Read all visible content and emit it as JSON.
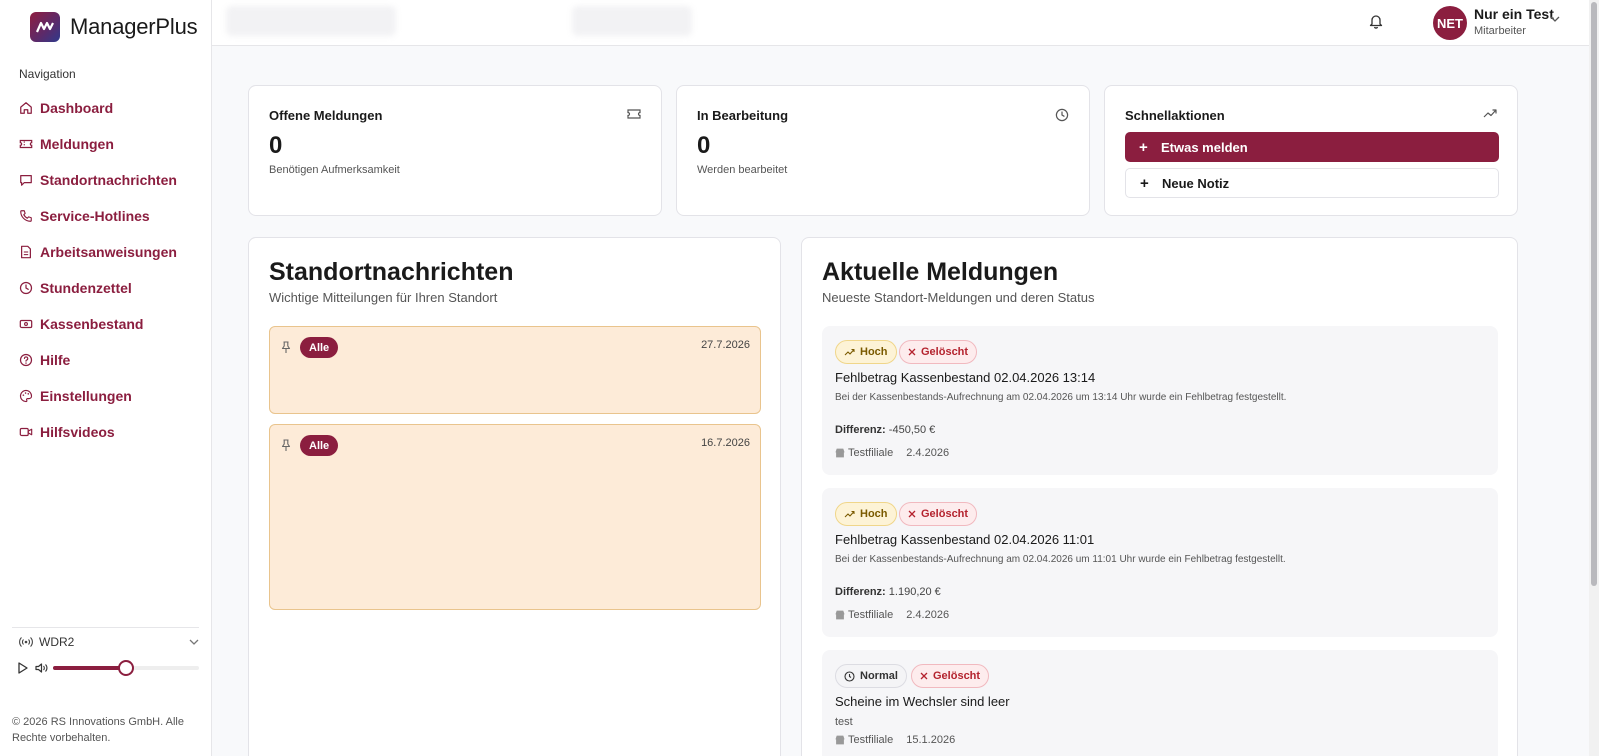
{
  "app": {
    "name": "ManagerPlus"
  },
  "sidebar": {
    "heading": "Navigation",
    "items": [
      {
        "label": "Dashboard",
        "icon": "home-icon"
      },
      {
        "label": "Meldungen",
        "icon": "ticket-icon"
      },
      {
        "label": "Standortnachrichten",
        "icon": "message-icon"
      },
      {
        "label": "Service-Hotlines",
        "icon": "phone-icon"
      },
      {
        "label": "Arbeitsanweisungen",
        "icon": "file-icon"
      },
      {
        "label": "Stundenzettel",
        "icon": "clock-icon"
      },
      {
        "label": "Kassenbestand",
        "icon": "cash-icon"
      },
      {
        "label": "Hilfe",
        "icon": "help-icon"
      },
      {
        "label": "Einstellungen",
        "icon": "palette-icon"
      },
      {
        "label": "Hilfsvideos",
        "icon": "video-icon"
      }
    ],
    "radio": {
      "station": "WDR2",
      "volume": 0.5
    },
    "footer": "© 2026 RS Innovations GmbH. Alle Rechte vorbehalten."
  },
  "header": {
    "user": {
      "initials": "NET",
      "name": "Nur ein Test",
      "role": "Mitarbeiter"
    }
  },
  "stats": {
    "open": {
      "title": "Offene Meldungen",
      "value": "0",
      "sub": "Benötigen Aufmerksamkeit"
    },
    "progress": {
      "title": "In Bearbeitung",
      "value": "0",
      "sub": "Werden bearbeitet"
    }
  },
  "quick_actions": {
    "title": "Schnellaktionen",
    "primary": "Etwas melden",
    "secondary": "Neue Notiz"
  },
  "location_news": {
    "title": "Standortnachrichten",
    "subtitle": "Wichtige Mitteilungen für Ihren Standort",
    "items": [
      {
        "badge": "Alle",
        "date": "27.7.2026"
      },
      {
        "badge": "Alle",
        "date": "16.7.2026"
      }
    ]
  },
  "reports": {
    "title": "Aktuelle Meldungen",
    "subtitle": "Neueste Standort-Meldungen und deren Status",
    "items": [
      {
        "priority": "Hoch",
        "status": "Gelöscht",
        "title": "Fehlbetrag Kassenbestand 02.04.2026 13:14",
        "description": "Bei der Kassenbestands-Aufrechnung am 02.04.2026 um 13:14 Uhr wurde ein Fehlbetrag festgestellt.",
        "diff_label": "Differenz:",
        "diff_value": "-450,50 €",
        "location": "Testfiliale",
        "date": "2.4.2026"
      },
      {
        "priority": "Hoch",
        "status": "Gelöscht",
        "title": "Fehlbetrag Kassenbestand 02.04.2026 11:01",
        "description": "Bei der Kassenbestands-Aufrechnung am 02.04.2026 um 11:01 Uhr wurde ein Fehlbetrag festgestellt.",
        "diff_label": "Differenz:",
        "diff_value": "1.190,20 €",
        "location": "Testfiliale",
        "date": "2.4.2026"
      },
      {
        "priority": "Normal",
        "status": "Gelöscht",
        "title": "Scheine im Wechsler sind leer",
        "description": "test",
        "location": "Testfiliale",
        "date": "15.1.2026"
      }
    ]
  },
  "colors": {
    "accent": "#8b1e3f",
    "news_bg": "#fdebd8",
    "news_border": "#e9c48d"
  }
}
